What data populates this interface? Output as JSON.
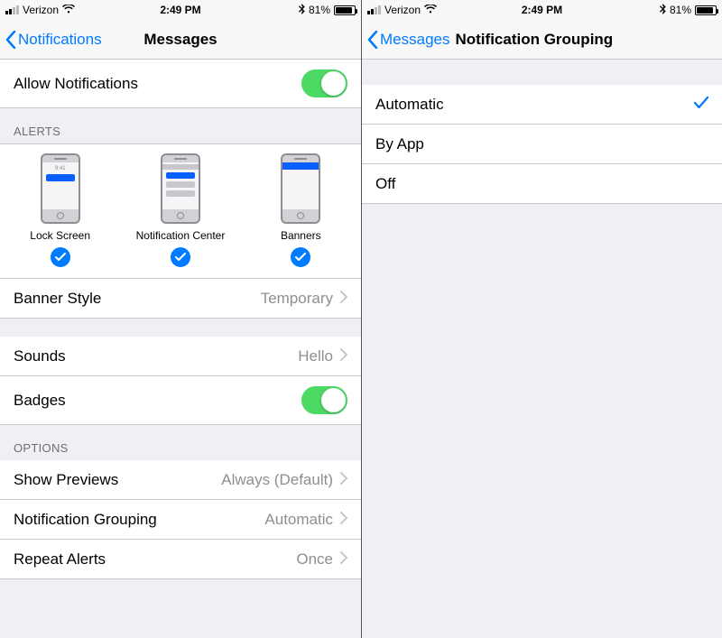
{
  "status": {
    "carrier": "Verizon",
    "time": "2:49 PM",
    "battery_pct": "81%"
  },
  "left": {
    "back_label": "Notifications",
    "title": "Messages",
    "allow_label": "Allow Notifications",
    "alerts_header": "ALERTS",
    "alert_tiles": {
      "lock": "Lock Screen",
      "nc": "Notification Center",
      "banners": "Banners",
      "mock_time": "9:41"
    },
    "banner_style_label": "Banner Style",
    "banner_style_value": "Temporary",
    "sounds_label": "Sounds",
    "sounds_value": "Hello",
    "badges_label": "Badges",
    "options_header": "OPTIONS",
    "show_previews_label": "Show Previews",
    "show_previews_value": "Always (Default)",
    "grouping_label": "Notification Grouping",
    "grouping_value": "Automatic",
    "repeat_label": "Repeat Alerts",
    "repeat_value": "Once"
  },
  "right": {
    "back_label": "Messages",
    "title": "Notification Grouping",
    "options": {
      "automatic": "Automatic",
      "byapp": "By App",
      "off": "Off"
    }
  }
}
